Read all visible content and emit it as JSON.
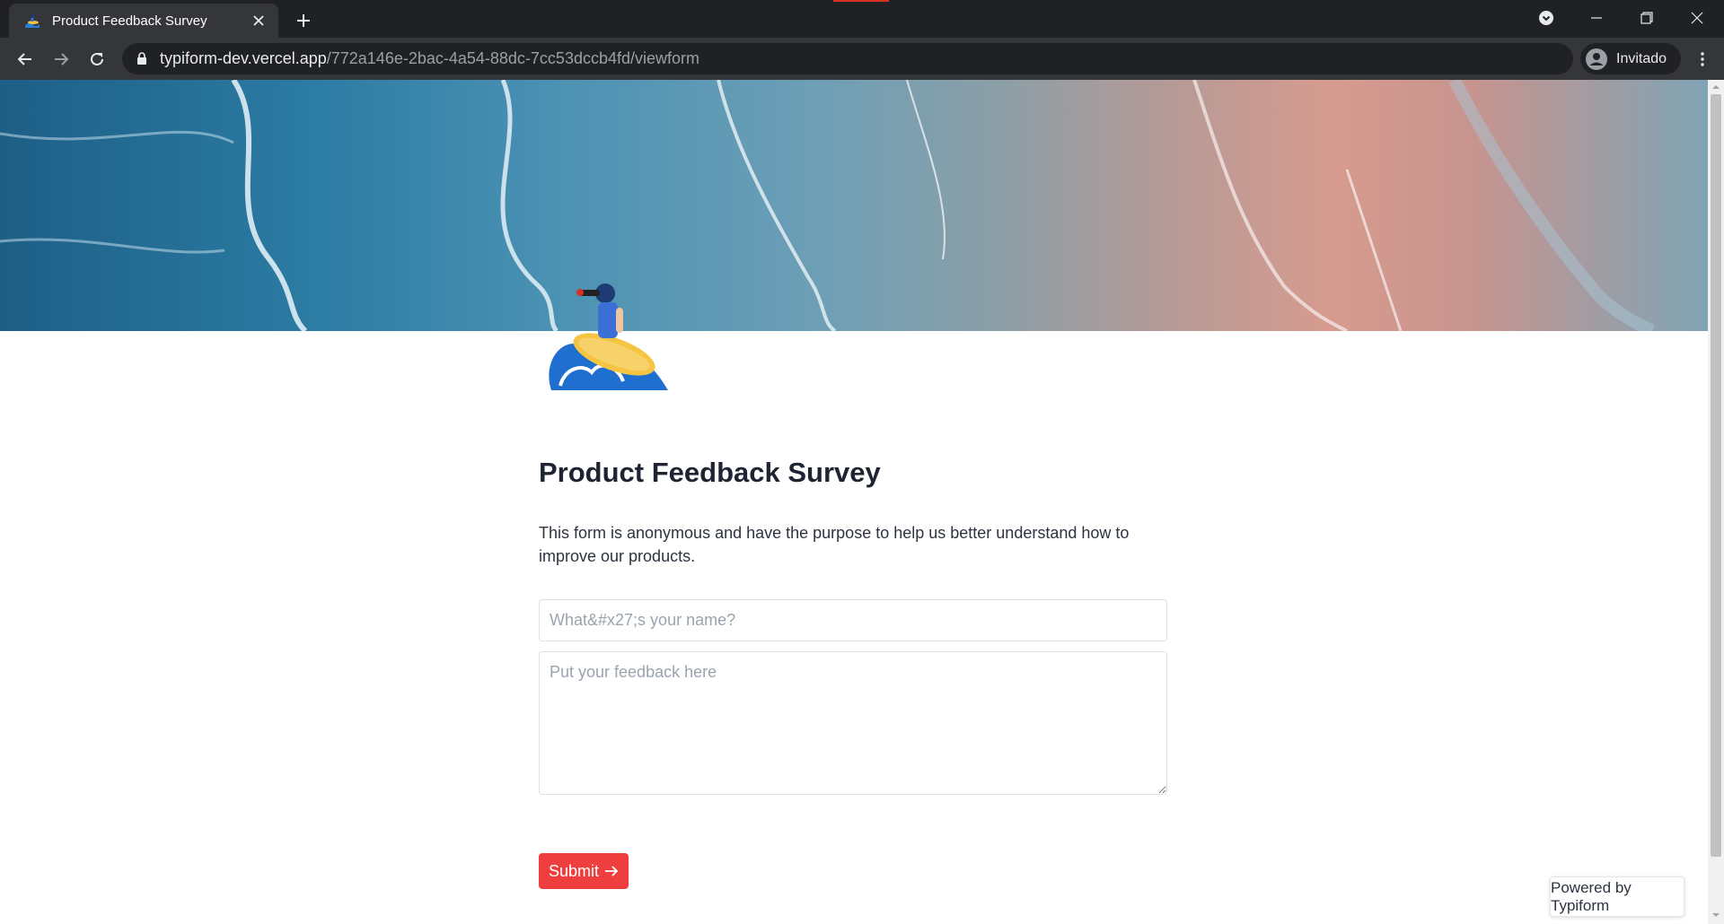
{
  "browser": {
    "tab_title": "Product Feedback Survey",
    "url_host": "typiform-dev.vercel.app",
    "url_path": "/772a146e-2bac-4a54-88dc-7cc53dccb4fd/viewform",
    "profile_label": "Invitado"
  },
  "form": {
    "title": "Product Feedback Survey",
    "description": "This form is anonymous and have the purpose to help us better understand how to improve our products.",
    "name_placeholder": "What&#x27;s your name?",
    "feedback_placeholder": "Put your feedback here",
    "submit_label": "Submit"
  },
  "footer": {
    "powered_by": "Powered by Typiform"
  },
  "colors": {
    "accent": "#ef3e3e",
    "title": "#1f2433",
    "browser_bg": "#202124"
  }
}
